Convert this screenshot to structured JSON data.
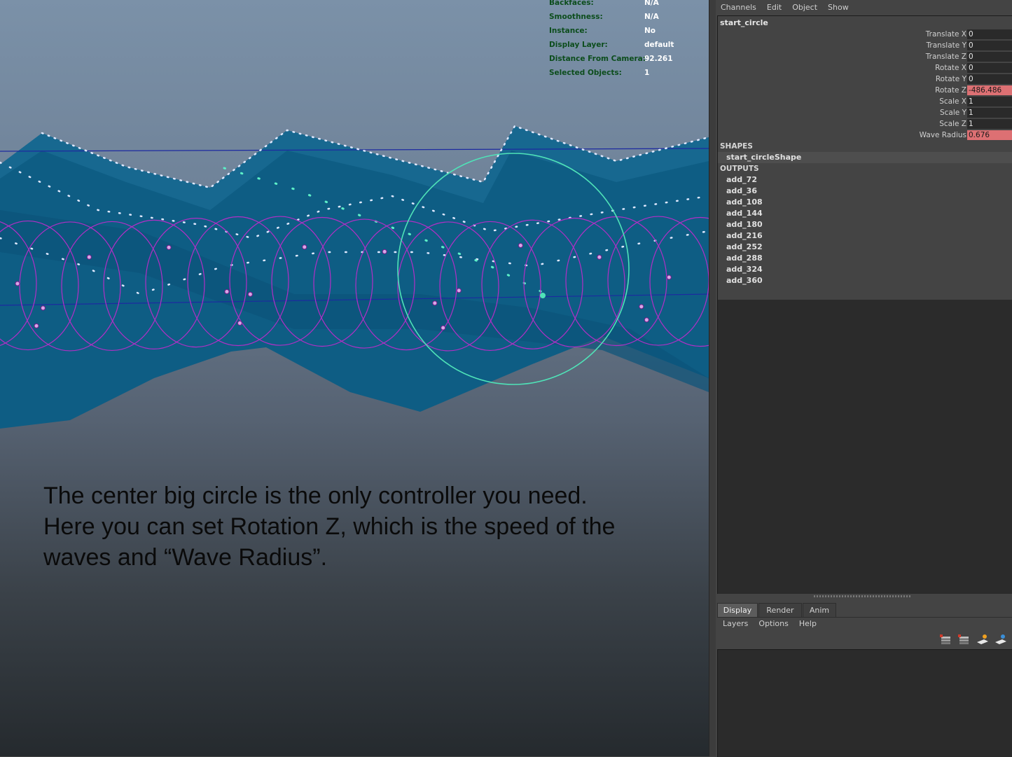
{
  "hud": [
    {
      "label": "Backfaces:",
      "value": "N/A"
    },
    {
      "label": "Smoothness:",
      "value": "N/A"
    },
    {
      "label": "Instance:",
      "value": "No"
    },
    {
      "label": "Display Layer:",
      "value": "default"
    },
    {
      "label": "Distance From Camera:",
      "value": "92.261"
    },
    {
      "label": "Selected Objects:",
      "value": "1"
    }
  ],
  "caption": {
    "line1": "The center big circle is the only controller you need.",
    "line2": "Here you can set Rotation Z, which is the speed of the",
    "line3": "waves and “Wave Radius”."
  },
  "channel_menu": [
    "Channels",
    "Edit",
    "Object",
    "Show"
  ],
  "channel_box": {
    "object": "start_circle",
    "attributes": [
      {
        "label": "Translate X",
        "value": "0",
        "keyed": false
      },
      {
        "label": "Translate Y",
        "value": "0",
        "keyed": false
      },
      {
        "label": "Translate Z",
        "value": "0",
        "keyed": false
      },
      {
        "label": "Rotate X",
        "value": "0",
        "keyed": false
      },
      {
        "label": "Rotate Y",
        "value": "0",
        "keyed": false
      },
      {
        "label": "Rotate Z",
        "value": "-486.486",
        "keyed": true
      },
      {
        "label": "Scale X",
        "value": "1",
        "keyed": false
      },
      {
        "label": "Scale Y",
        "value": "1",
        "keyed": false
      },
      {
        "label": "Scale Z",
        "value": "1",
        "keyed": false
      },
      {
        "label": "Wave Radius",
        "value": "0.676",
        "keyed": true
      }
    ],
    "shapes_label": "SHAPES",
    "shape": "start_circleShape",
    "outputs_label": "OUTPUTS",
    "outputs": [
      "add_72",
      "add_36",
      "add_108",
      "add_144",
      "add_180",
      "add_216",
      "add_252",
      "add_288",
      "add_324",
      "add_360"
    ]
  },
  "layer_tabs": [
    "Display",
    "Render",
    "Anim"
  ],
  "layer_menu": [
    "Layers",
    "Options",
    "Help"
  ],
  "layer_icons": [
    "new-layer-icon",
    "new-layer-selected-icon",
    "create-empty-layer-icon",
    "create-layer-from-selected-icon"
  ],
  "colors": {
    "wave_surface": "#0f5f86",
    "controller_circle": "#4fe3b8",
    "ring_circles": "#b22fc6",
    "keyed_channel": "#dd7073",
    "hud_label": "#0c4d1c"
  }
}
